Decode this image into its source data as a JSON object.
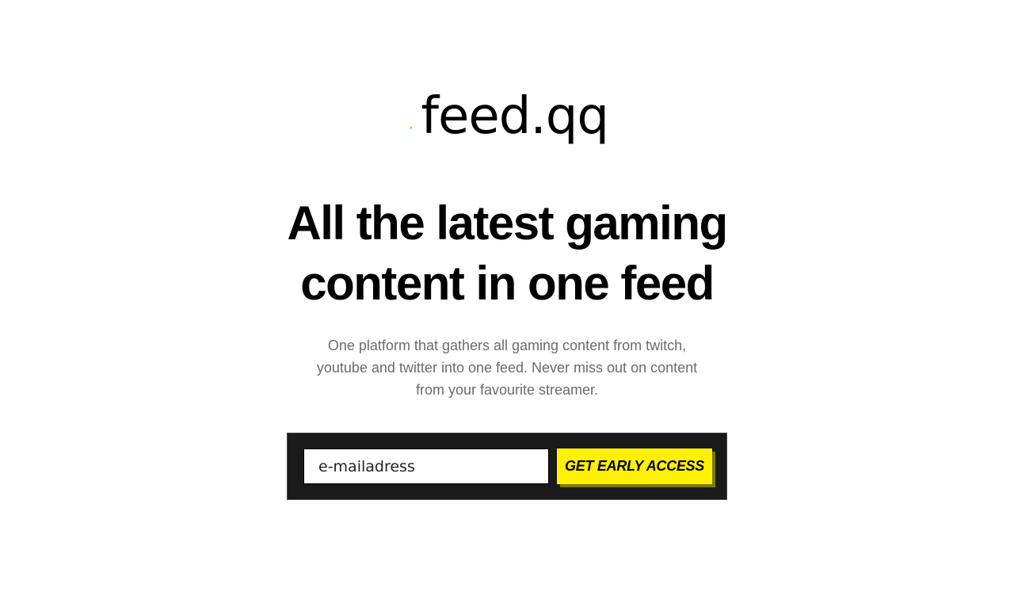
{
  "brand": {
    "name": "feed.qq",
    "logo_icon": "play-arrow-icon",
    "colors": [
      "#fcd116",
      "#ff7a00",
      "#e8177d",
      "#8a1fa8"
    ]
  },
  "hero": {
    "headline": "All the latest gaming content in one feed",
    "subtitle": "One platform that gathers all gaming content from twitch, youtube and twitter into one feed. Never miss out on content from your favourite streamer."
  },
  "signup": {
    "email_placeholder": "e-mailadress",
    "email_value": "",
    "cta_label": "GET EARLY ACCESS",
    "panel_color": "#1a1a1a",
    "cta_color": "#fff200"
  }
}
